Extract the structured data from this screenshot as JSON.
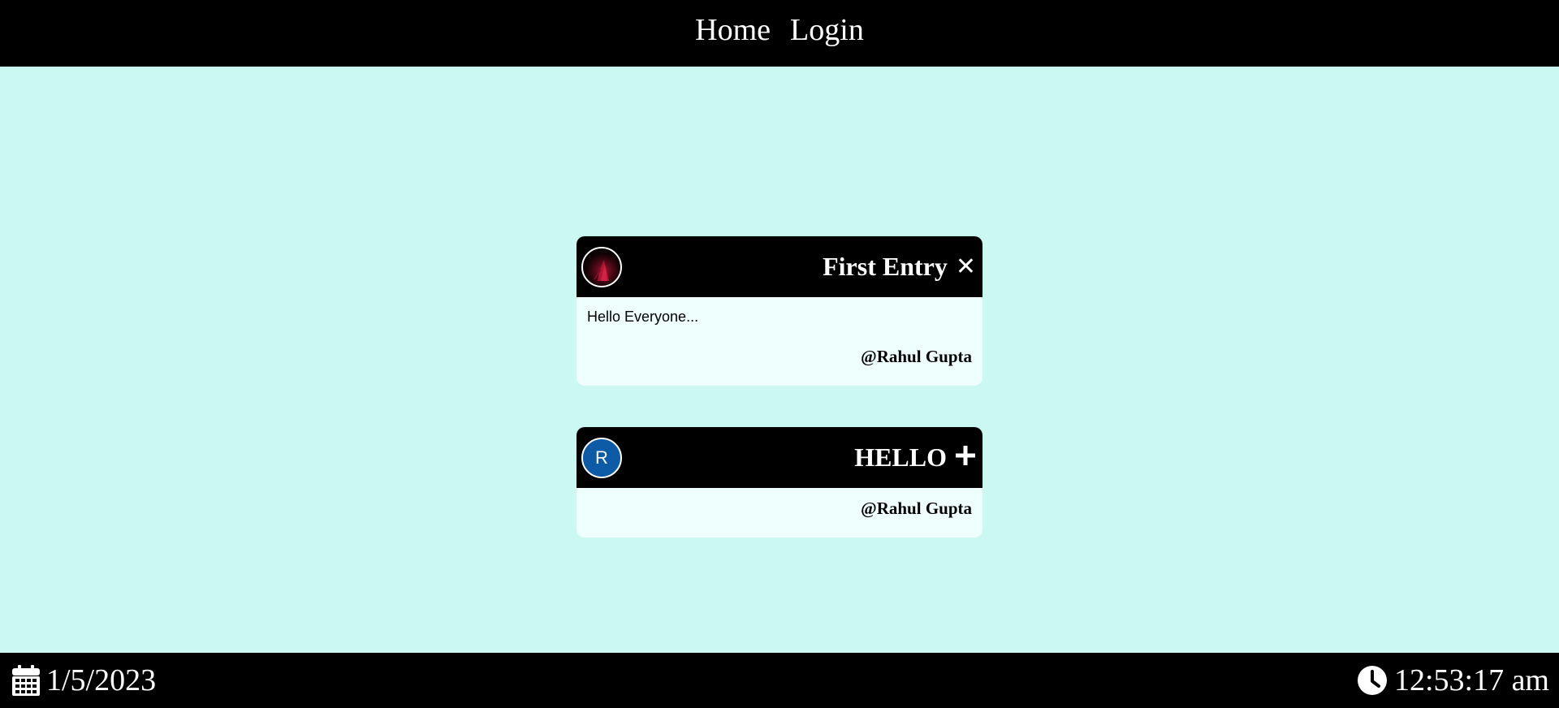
{
  "nav": {
    "home": "Home",
    "login": "Login"
  },
  "notes": [
    {
      "avatar": "image",
      "title": "First Entry",
      "action_icon": "close-icon",
      "body": "Hello Everyone...",
      "author": "@Rahul Gupta"
    },
    {
      "avatar_letter": "R",
      "title": "HELLO",
      "action_icon": "plus-icon",
      "body": "",
      "author": "@Rahul Gupta"
    }
  ],
  "footer": {
    "date": "1/5/2023",
    "time": "12:53:17 am",
    "date_icon": "calendar-icon",
    "time_icon": "clock-icon"
  },
  "colors": {
    "background": "#cbf9f1",
    "card_body": "#effffd",
    "bars": "#000000",
    "avatar_blue": "#0d5aa7"
  }
}
